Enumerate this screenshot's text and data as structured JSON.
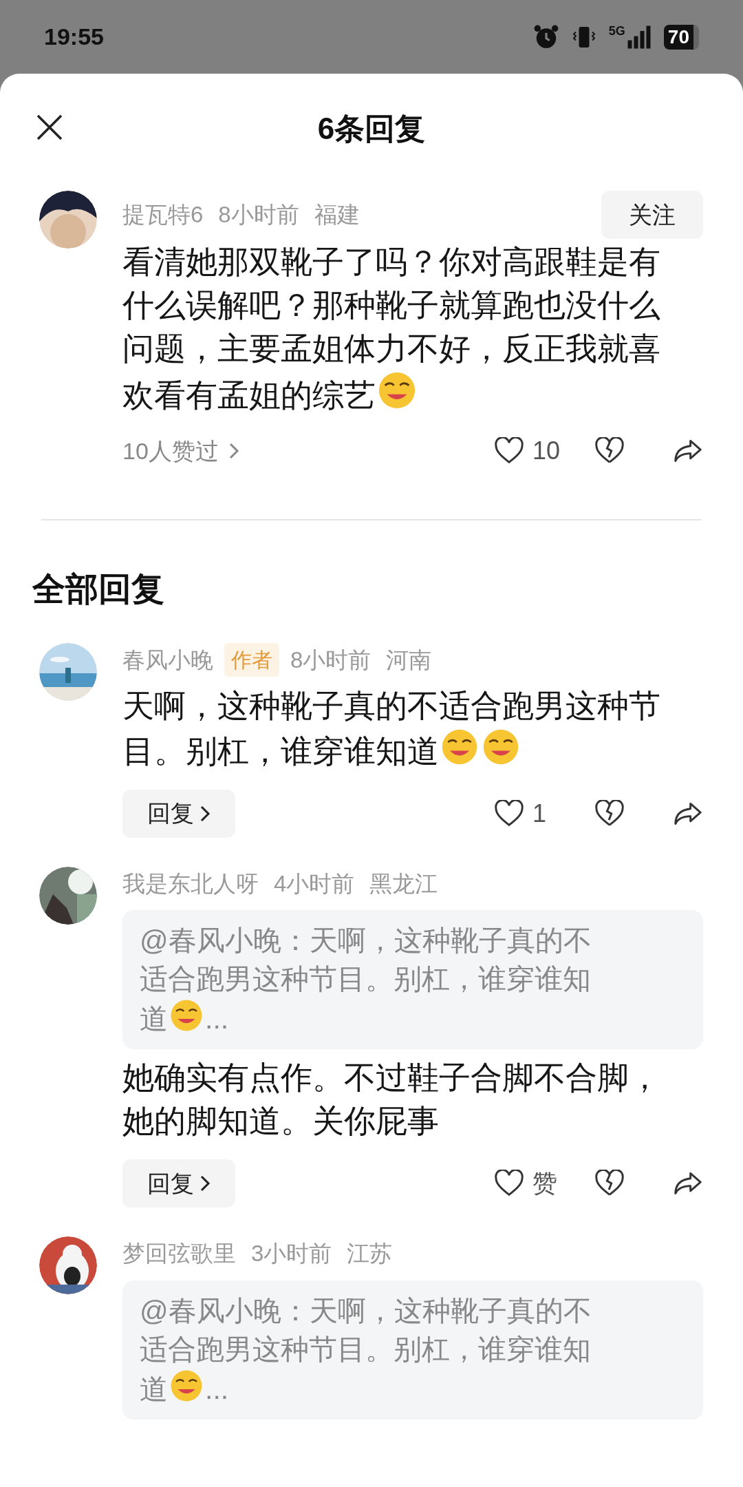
{
  "status_bar": {
    "time": "19:55",
    "network": "5G",
    "battery": "70"
  },
  "header": {
    "title": "6条回复"
  },
  "main_comment": {
    "user": "提瓦特6",
    "time": "8小时前",
    "location": "福建",
    "follow_label": "关注",
    "followed": false,
    "body": [
      {
        "kind": "text",
        "text": "看清她那双靴子了吗？你对高跟鞋是有什么误解吧？那种靴子就算跑也没什么问题，主要孟姐体力不好，反正我就喜欢看有孟姐的综艺"
      },
      {
        "kind": "emoji"
      }
    ],
    "liked_by": "10人赞过",
    "likes": "10",
    "liked": false
  },
  "section_title": "全部回复",
  "replies": [
    {
      "user": "春风小晚",
      "badge": "作者",
      "time": "8小时前",
      "location": "河南",
      "body": [
        {
          "kind": "text",
          "text": "天啊，这种靴子真的不适合跑男这种节目。别杠，谁穿谁知道"
        },
        {
          "kind": "emoji"
        },
        {
          "kind": "emoji"
        }
      ],
      "reply_label": "回复",
      "likes": "1",
      "liked": false
    },
    {
      "user": "我是东北人呀",
      "time": "4小时前",
      "location": "黑龙江",
      "quote": [
        {
          "kind": "text",
          "text": "@春风小晚：天啊，这种靴子真的不适合跑男这种节目。别杠，谁穿谁知道"
        },
        {
          "kind": "emoji"
        },
        {
          "kind": "text",
          "text": "..."
        }
      ],
      "body": [
        {
          "kind": "text",
          "text": "她确实有点作。不过鞋子合脚不合脚，她的脚知道。关你屁事"
        }
      ],
      "reply_label": "回复",
      "likes": "赞",
      "liked": false
    },
    {
      "user": "梦回弦歌里",
      "time": "3小时前",
      "location": "江苏",
      "quote": [
        {
          "kind": "text",
          "text": "@春风小晚：天啊，这种靴子真的不适合跑男这种节目。别杠，谁穿谁知道"
        },
        {
          "kind": "emoji"
        },
        {
          "kind": "text",
          "text": "..."
        }
      ]
    }
  ]
}
